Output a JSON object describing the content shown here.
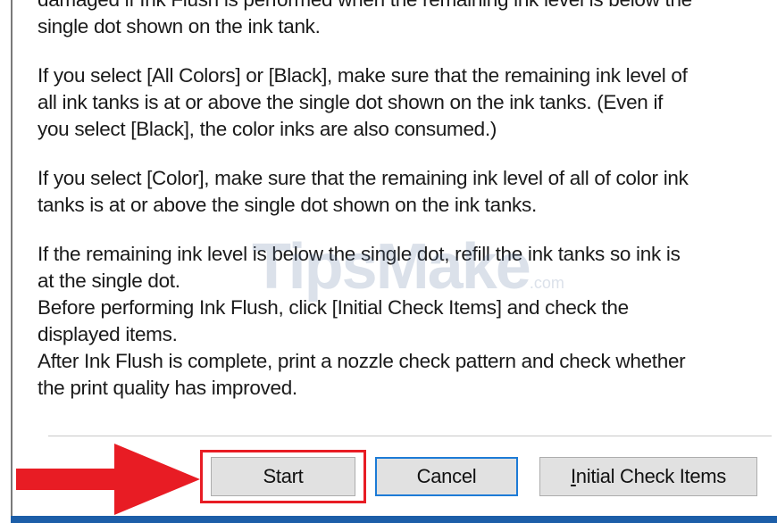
{
  "dialog": {
    "paragraphs": [
      [
        "damaged if Ink Flush is performed when the remaining ink level is below the",
        "single dot shown on the ink tank."
      ],
      [
        "If you select [All Colors] or [Black], make sure that the remaining ink level of",
        "all ink tanks is at or above the single dot shown on the ink tanks. (Even if",
        "you select [Black], the color inks are also consumed.)"
      ],
      [
        "If you select [Color], make sure that the remaining ink level of all of color ink",
        "tanks is at or above the single dot shown on the ink tanks."
      ],
      [
        "If the remaining ink level is below the single dot, refill the ink tanks so ink is",
        "at the single dot.",
        "Before performing Ink Flush, click [Initial Check Items] and check the",
        "displayed items.",
        "After Ink Flush is complete, print a nozzle check pattern and check whether",
        "the print quality has improved."
      ]
    ],
    "buttons": {
      "start": "Start",
      "cancel": "Cancel",
      "initial_check_mnemonic": "I",
      "initial_check_rest": "nitial Check Items"
    }
  },
  "watermark": {
    "brand": "TipsMake",
    "suffix": ".com"
  },
  "colors": {
    "highlight": "#e81c24",
    "arrow": "#e81c24",
    "focus_border": "#1d7bd6",
    "bottom_bar": "#1c5ea8"
  },
  "icons": [
    "red-arrow-icon"
  ]
}
